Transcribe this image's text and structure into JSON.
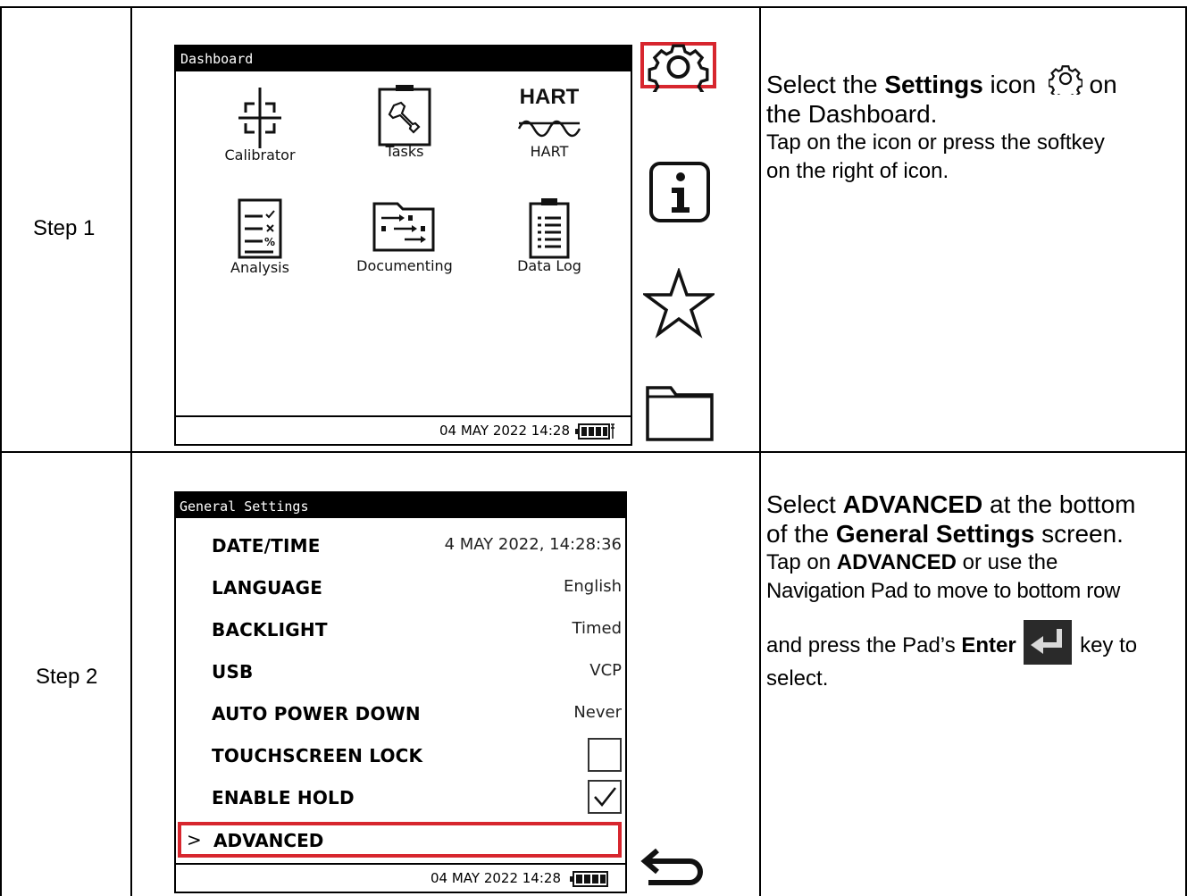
{
  "steps": [
    {
      "label": "Step 1",
      "screen": {
        "title": "Dashboard",
        "apps": [
          {
            "label": "Calibrator",
            "icon": "crosshair-icon"
          },
          {
            "label": "Tasks",
            "icon": "wrench-clipboard-icon"
          },
          {
            "label": "HART",
            "icon": "hart-wave-icon",
            "icon_text": "HART"
          },
          {
            "label": "Analysis",
            "icon": "checklist-icon"
          },
          {
            "label": "Documenting",
            "icon": "folder-flow-icon"
          },
          {
            "label": "Data Log",
            "icon": "clipboard-list-icon"
          }
        ],
        "status": {
          "datetime": "04 MAY 2022 14:28",
          "battery_icon": "battery-charging-icon"
        }
      },
      "side_icons": [
        "gear-icon",
        "info-icon",
        "star-icon",
        "folder-icon"
      ],
      "instruction": {
        "line1_pre": "Select the ",
        "line1_bold": "Settings",
        "line1_post": " icon",
        "line1_end": " on",
        "line2": "the Dashboard.",
        "sub1": "Tap on the icon or press the softkey",
        "sub2": "on the right of icon."
      }
    },
    {
      "label": "Step 2",
      "screen": {
        "title": "General Settings",
        "rows": [
          {
            "key": "DATE/TIME",
            "value": "4 MAY 2022, 14:28:36"
          },
          {
            "key": "LANGUAGE",
            "value": "English"
          },
          {
            "key": "BACKLIGHT",
            "value": "Timed"
          },
          {
            "key": "USB",
            "value": "VCP"
          },
          {
            "key": "AUTO POWER DOWN",
            "value": "Never"
          },
          {
            "key": "TOUCHSCREEN LOCK",
            "checked": false
          },
          {
            "key": "ENABLE HOLD",
            "checked": true
          }
        ],
        "advanced": {
          "arrow": ">",
          "label": "ADVANCED"
        },
        "status": {
          "datetime": "04 MAY 2022 14:28",
          "battery_icon": "battery-icon"
        }
      },
      "side_icons": [
        "back-arrow-icon"
      ],
      "instruction": {
        "l1_pre": "Select ",
        "l1_bold": "ADVANCED",
        "l1_post": " at the bottom",
        "l2_pre": "of the ",
        "l2_bold": "General Settings",
        "l2_post": " screen.",
        "s1_pre": "Tap on ",
        "s1_bold": "ADVANCED",
        "s1_post": " or use the",
        "s2": "Navigation Pad to move to bottom row",
        "s3_pre": "and press the Pad’s ",
        "s3_bold": "Enter",
        "s3_post": " key to",
        "s4": "select."
      }
    }
  ],
  "colors": {
    "highlight": "#d7262e",
    "border": "#000000"
  }
}
